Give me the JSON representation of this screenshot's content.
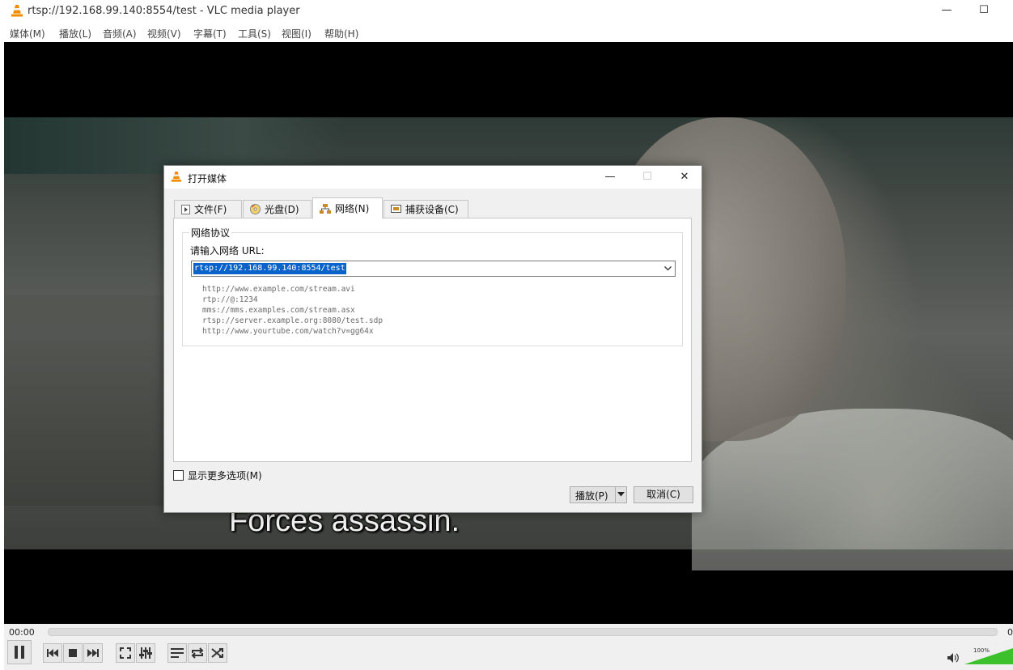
{
  "window": {
    "title": "rtsp://192.168.99.140:8554/test - VLC media player",
    "minimize_glyph": "—",
    "maximize_glyph": "☐"
  },
  "menu": [
    "媒体(M)",
    "播放(L)",
    "音频(A)",
    "视频(V)",
    "字幕(T)",
    "工具(S)",
    "视图(I)",
    "帮助(H)"
  ],
  "video": {
    "subtitle": "Forces assassin."
  },
  "controls": {
    "time_elapsed": "00:00",
    "time_total": "0",
    "volume_label": "100%",
    "volume_level": 1.0,
    "accent_color": "#3cc02c"
  },
  "dialog": {
    "title": "打开媒体",
    "tabs": [
      {
        "label": "文件(F)",
        "icon": "file-play-icon"
      },
      {
        "label": "光盘(D)",
        "icon": "disc-icon"
      },
      {
        "label": "网络(N)",
        "icon": "network-icon",
        "active": true
      },
      {
        "label": "捕获设备(C)",
        "icon": "capture-device-icon"
      }
    ],
    "group_title": "网络协议",
    "url_label": "请输入网络 URL:",
    "url_value": "rtsp://192.168.99.140:8554/test",
    "examples": [
      "http://www.example.com/stream.avi",
      "rtp://@:1234",
      "mms://mms.examples.com/stream.asx",
      "rtsp://server.example.org:8080/test.sdp",
      "http://www.yourtube.com/watch?v=gg64x"
    ],
    "more_options_label": "显示更多选项(M)",
    "play_label": "播放(P)",
    "cancel_label": "取消(C)",
    "close_glyph": "✕"
  }
}
